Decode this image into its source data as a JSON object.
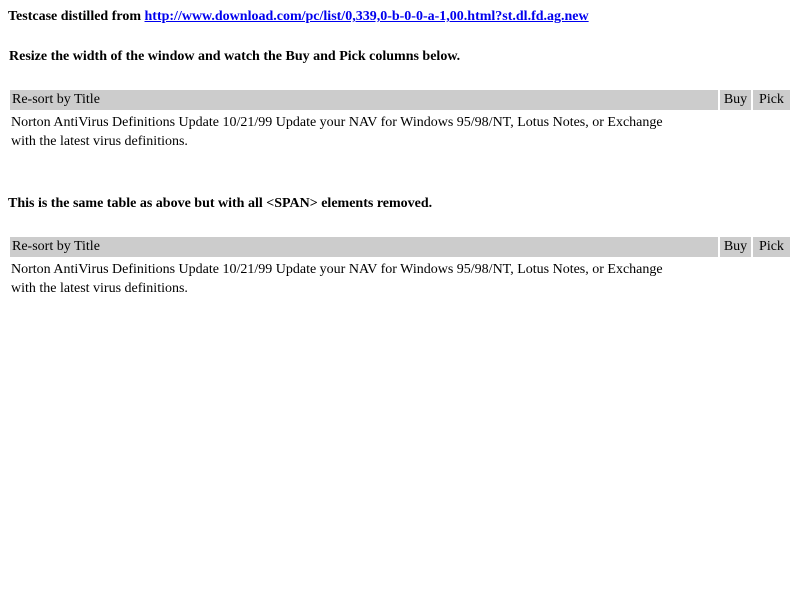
{
  "intro": {
    "prefix": "Testcase distilled from",
    "link_text": "http://www.download.com/pc/list/0,339,0-b-0-0-a-1,00.html?st.dl.fd.ag.new"
  },
  "note1": "Resize the width of the window and watch the Buy and Pick columns below.",
  "note2": "This is the same table as above but with all <SPAN> elements removed.",
  "tables": [
    {
      "headers": {
        "title": "Re-sort by Title",
        "buy": "Buy",
        "pick": "Pick"
      },
      "row": {
        "description": "Norton AntiVirus Definitions Update 10/21/99 Update your NAV for Windows 95/98/NT, Lotus Notes, or Exchange with the latest virus definitions."
      }
    },
    {
      "headers": {
        "title": "Re-sort by Title",
        "buy": "Buy",
        "pick": "Pick"
      },
      "row": {
        "description": "Norton AntiVirus Definitions Update 10/21/99 Update your NAV for Windows 95/98/NT, Lotus Notes, or Exchange with the latest virus definitions."
      }
    }
  ]
}
